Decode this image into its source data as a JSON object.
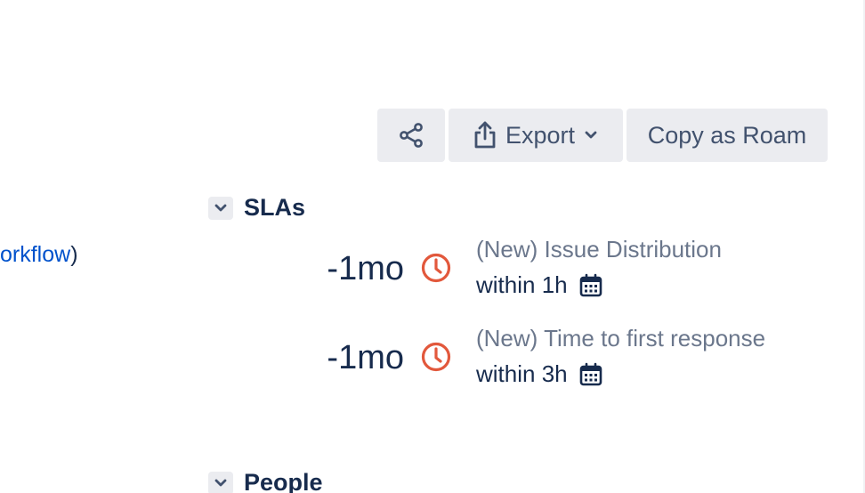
{
  "toolbar": {
    "share_icon": "share-icon",
    "export_label": "Export",
    "copy_label": "Copy as Roam"
  },
  "left": {
    "link_text": "orkflow",
    "suffix": ")"
  },
  "slas": {
    "title": "SLAs",
    "items": [
      {
        "time": "-1mo",
        "name": "(New) Issue Distribution",
        "goal": "within 1h"
      },
      {
        "time": "-1mo",
        "name": "(New) Time to first response",
        "goal": "within 3h"
      }
    ]
  },
  "people": {
    "title": "People"
  },
  "colors": {
    "accent_red": "#E2583C",
    "link_blue": "#0052CC",
    "text_dark": "#172B4D",
    "text_muted": "#6B778C",
    "button_bg": "#EBECF0"
  }
}
